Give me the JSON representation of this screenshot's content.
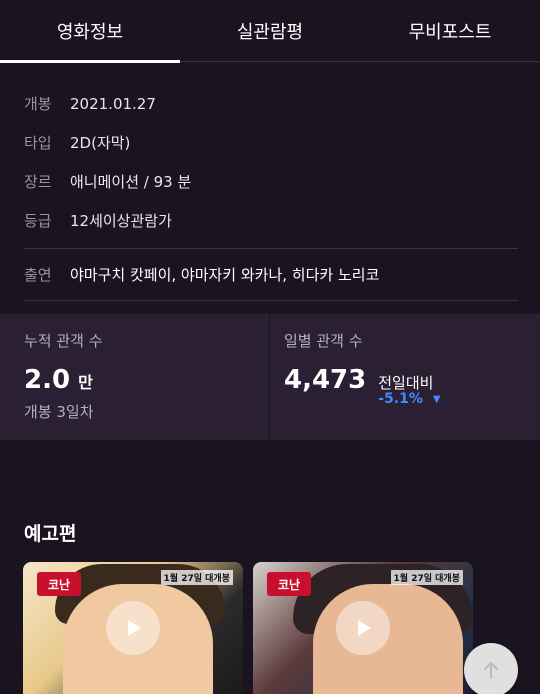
{
  "tabs": [
    {
      "label": "영화정보",
      "active": true
    },
    {
      "label": "실관람평",
      "active": false
    },
    {
      "label": "무비포스트",
      "active": false
    }
  ],
  "info": {
    "rows": [
      {
        "label": "개봉",
        "value": "2021.01.27"
      },
      {
        "label": "타입",
        "value": "2D(자막)"
      },
      {
        "label": "장르",
        "value": "애니메이션 / 93 분"
      },
      {
        "label": "등급",
        "value": "12세이상관람가"
      }
    ],
    "cast": {
      "label": "출연",
      "value": "야마구치 캇페이, 야마자키 와카나, 히다카 노리코"
    }
  },
  "stats": {
    "cumulative": {
      "title": "누적 관객 수",
      "value": "2.0",
      "unit": "만",
      "sub": "개봉 3일차"
    },
    "daily": {
      "title": "일별 관객 수",
      "value": "4,473",
      "compare_label": "전일대비",
      "compare_value": "-5.1%",
      "compare_icon": "triangle-down-icon"
    }
  },
  "trailers": {
    "title": "예고편",
    "items": [
      {
        "badge": "1월 27일 대개봉",
        "logo": "코난"
      },
      {
        "badge": "1월 27일 대개봉",
        "logo": "코난"
      }
    ]
  },
  "colors": {
    "background": "#1a1320",
    "stats_background": "#2b2033",
    "accent_blue": "#3d8bff"
  }
}
